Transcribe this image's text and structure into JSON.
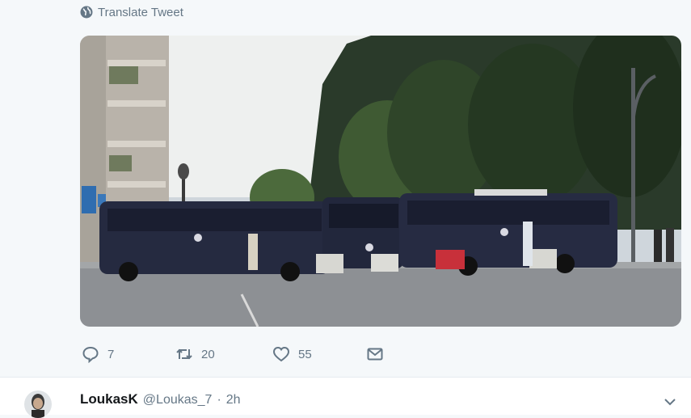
{
  "translate": {
    "label": "Translate Tweet",
    "icon": "globe-icon"
  },
  "media": {
    "description_icon": "photo"
  },
  "actions": {
    "reply": {
      "icon": "reply-icon",
      "count": "7"
    },
    "retweet": {
      "icon": "retweet-icon",
      "count": "20"
    },
    "like": {
      "icon": "heart-icon",
      "count": "55"
    },
    "dm": {
      "icon": "envelope-icon"
    }
  },
  "next_tweet": {
    "name": "LoukasK",
    "handle": "@Loukas_7",
    "separator": "·",
    "time": "2h",
    "menu_icon": "chevron-down-icon"
  },
  "colors": {
    "secondary_text": "#657786",
    "background": "#f5f8fa",
    "divider": "#e6ecf0"
  }
}
